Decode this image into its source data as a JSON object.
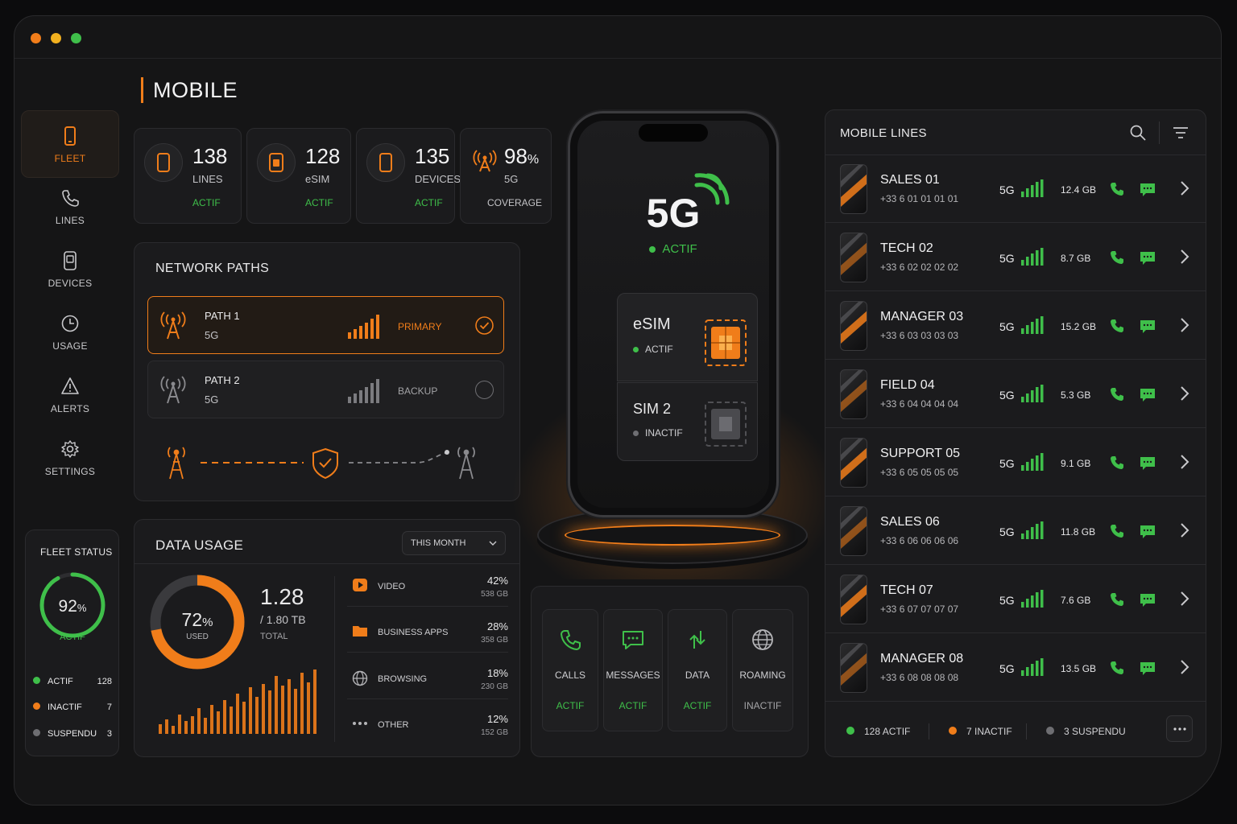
{
  "page": {
    "title": "MOBILE"
  },
  "colors": {
    "accent": "#f07d1a",
    "active": "#3fbf4a",
    "inactive": "#6e6e72",
    "background": "#151516"
  },
  "sidebar": {
    "items": [
      {
        "label": "FLEET",
        "icon": "phone-icon",
        "active": true
      },
      {
        "label": "LINES",
        "icon": "handset-icon"
      },
      {
        "label": "DEVICES",
        "icon": "device-icon"
      },
      {
        "label": "USAGE",
        "icon": "clock-icon"
      },
      {
        "label": "ALERTS",
        "icon": "alert-icon"
      },
      {
        "label": "SETTINGS",
        "icon": "gear-icon"
      }
    ]
  },
  "fleet_status": {
    "title": "FLEET STATUS",
    "percent": "92",
    "percent_unit": "%",
    "percent_value": 92,
    "state": "ACTIF",
    "legend": [
      {
        "label": "ACTIF",
        "count": "128",
        "color": "#3fbf4a"
      },
      {
        "label": "INACTIF",
        "count": "7",
        "color": "#f07d1a"
      },
      {
        "label": "SUSPENDU",
        "count": "3",
        "color": "#6e6e72"
      }
    ]
  },
  "stats": [
    {
      "value": "138",
      "label": "LINES",
      "status": "ACTIF",
      "icon": "phone-icon"
    },
    {
      "value": "128",
      "label": "eSIM",
      "status": "ACTIF",
      "icon": "sim-icon"
    },
    {
      "value": "135",
      "label": "DEVICES",
      "status": "ACTIF",
      "icon": "phone-icon"
    },
    {
      "value": "98",
      "unit": "%",
      "label": "5G",
      "status": "COVERAGE",
      "icon": "antenna-icon"
    }
  ],
  "network_paths": {
    "title": "NETWORK PATHS",
    "paths": [
      {
        "name": "PATH 1",
        "band": "5G",
        "role": "PRIMARY",
        "selected": true
      },
      {
        "name": "PATH 2",
        "band": "5G",
        "role": "BACKUP",
        "selected": false
      }
    ]
  },
  "data_usage": {
    "title": "DATA USAGE",
    "period": "THIS MONTH",
    "used_percent": "72",
    "used_unit": "%",
    "used_percent_value": 72,
    "used_label": "USED",
    "used_value": "1.28",
    "total_value": "/ 1.80 TB",
    "total_label": "TOTAL",
    "categories": [
      {
        "name": "VIDEO",
        "percent": "42%",
        "size": "538 GB",
        "icon": "play-icon"
      },
      {
        "name": "BUSINESS APPS",
        "percent": "28%",
        "size": "358 GB",
        "icon": "folder-icon"
      },
      {
        "name": "BROWSING",
        "percent": "18%",
        "size": "230 GB",
        "icon": "globe-icon"
      },
      {
        "name": "OTHER",
        "percent": "12%",
        "size": "152 GB",
        "icon": "more-icon"
      }
    ]
  },
  "hero": {
    "network": "5G",
    "status": "ACTIF",
    "sims": [
      {
        "name": "eSIM",
        "status": "ACTIF"
      },
      {
        "name": "SIM 2",
        "status": "INACTIF"
      }
    ]
  },
  "features": [
    {
      "label": "CALLS",
      "status": "ACTIF",
      "icon": "phone-call-icon"
    },
    {
      "label": "MESSAGES",
      "status": "ACTIF",
      "icon": "message-icon"
    },
    {
      "label": "DATA",
      "status": "ACTIF",
      "icon": "data-transfer-icon"
    },
    {
      "label": "ROAMING",
      "status": "INACTIF",
      "icon": "globe-icon"
    }
  ],
  "mobile_lines": {
    "title": "MOBILE LINES",
    "lines": [
      {
        "name": "SALES 01",
        "number": "+33 6 01 01 01 01",
        "band": "5G",
        "usage": "12.4 GB"
      },
      {
        "name": "TECH 02",
        "number": "+33 6 02 02 02 02",
        "band": "5G",
        "usage": "8.7 GB"
      },
      {
        "name": "MANAGER 03",
        "number": "+33 6 03 03 03 03",
        "band": "5G",
        "usage": "15.2 GB"
      },
      {
        "name": "FIELD 04",
        "number": "+33 6 04 04 04 04",
        "band": "5G",
        "usage": "5.3 GB"
      },
      {
        "name": "SUPPORT 05",
        "number": "+33 6 05 05 05 05",
        "band": "5G",
        "usage": "9.1 GB"
      },
      {
        "name": "SALES 06",
        "number": "+33 6 06 06 06 06",
        "band": "5G",
        "usage": "11.8 GB"
      },
      {
        "name": "TECH 07",
        "number": "+33 6 07 07 07 07",
        "band": "5G",
        "usage": "7.6 GB"
      },
      {
        "name": "MANAGER 08",
        "number": "+33 6 08 08 08 08",
        "band": "5G",
        "usage": "13.5 GB"
      }
    ],
    "footer": [
      {
        "label": "128 ACTIF",
        "color": "#3fbf4a"
      },
      {
        "label": "7 INACTIF",
        "color": "#f07d1a"
      },
      {
        "label": "3 SUSPENDU",
        "color": "#6e6e72"
      }
    ]
  }
}
